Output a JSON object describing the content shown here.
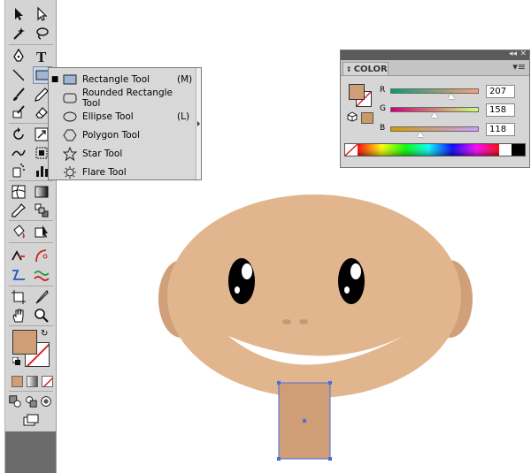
{
  "flyout": {
    "items": [
      {
        "label": "Rectangle Tool",
        "shortcut": "(M)",
        "selected": true
      },
      {
        "label": "Rounded Rectangle Tool",
        "shortcut": ""
      },
      {
        "label": "Ellipse Tool",
        "shortcut": "(L)"
      },
      {
        "label": "Polygon Tool",
        "shortcut": ""
      },
      {
        "label": "Star Tool",
        "shortcut": ""
      },
      {
        "label": "Flare Tool",
        "shortcut": ""
      }
    ]
  },
  "color_panel": {
    "title": "COLOR",
    "r": {
      "label": "R",
      "value": "207"
    },
    "g": {
      "label": "G",
      "value": "158"
    },
    "b": {
      "label": "B",
      "value": "118"
    }
  },
  "colors": {
    "fill": "#cf9e76",
    "face": "#e1b68f",
    "ears": "#cfa07a",
    "neck": "#cf9e76",
    "selection": "#4a6ee0"
  },
  "toolbar_icons": [
    "selection-icon",
    "direct-selection-icon",
    "magic-wand-icon",
    "lasso-icon",
    "pen-icon",
    "type-icon",
    "line-segment-icon",
    "rectangle-icon",
    "paintbrush-icon",
    "pencil-icon",
    "blob-brush-icon",
    "eraser-icon",
    "rotate-icon",
    "scale-icon",
    "warp-icon",
    "free-transform-icon",
    "symbol-sprayer-icon",
    "column-graph-icon",
    "mesh-icon",
    "gradient-icon",
    "eyedropper-icon",
    "blend-icon",
    "live-paint-bucket-icon",
    "live-paint-selection-icon",
    "artboard-icon",
    "slice-icon",
    "hand-icon",
    "zoom-icon"
  ]
}
